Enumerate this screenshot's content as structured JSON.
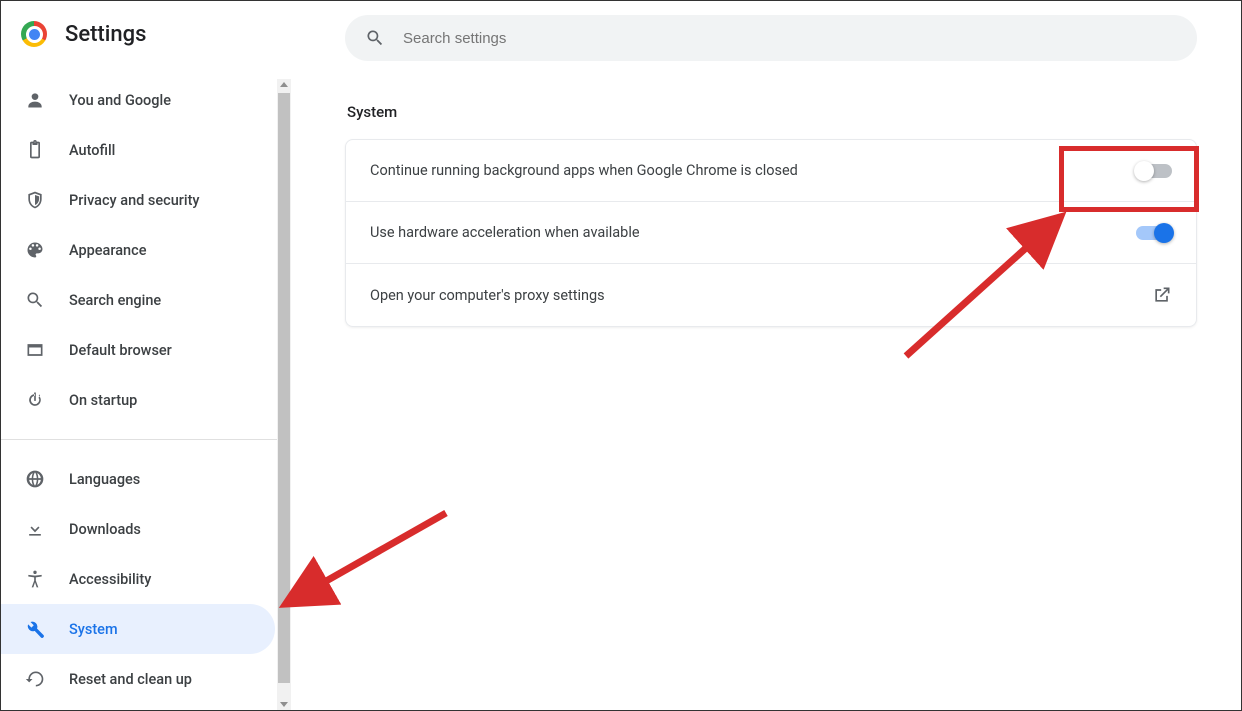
{
  "header": {
    "title": "Settings"
  },
  "search": {
    "placeholder": "Search settings"
  },
  "sidebar": {
    "group1": [
      {
        "icon": "person",
        "label": "You and Google"
      },
      {
        "icon": "clipboard",
        "label": "Autofill"
      },
      {
        "icon": "shield",
        "label": "Privacy and security"
      },
      {
        "icon": "palette",
        "label": "Appearance"
      },
      {
        "icon": "search",
        "label": "Search engine"
      },
      {
        "icon": "browser",
        "label": "Default browser"
      },
      {
        "icon": "power",
        "label": "On startup"
      }
    ],
    "group2": [
      {
        "icon": "globe",
        "label": "Languages"
      },
      {
        "icon": "download",
        "label": "Downloads"
      },
      {
        "icon": "accessibility",
        "label": "Accessibility"
      },
      {
        "icon": "wrench",
        "label": "System",
        "active": true
      },
      {
        "icon": "restore",
        "label": "Reset and clean up"
      }
    ]
  },
  "main": {
    "section_title": "System",
    "rows": [
      {
        "label": "Continue running background apps when Google Chrome is closed",
        "type": "toggle",
        "state": "off"
      },
      {
        "label": "Use hardware acceleration when available",
        "type": "toggle",
        "state": "on"
      },
      {
        "label": "Open your computer's proxy settings",
        "type": "link"
      }
    ]
  }
}
